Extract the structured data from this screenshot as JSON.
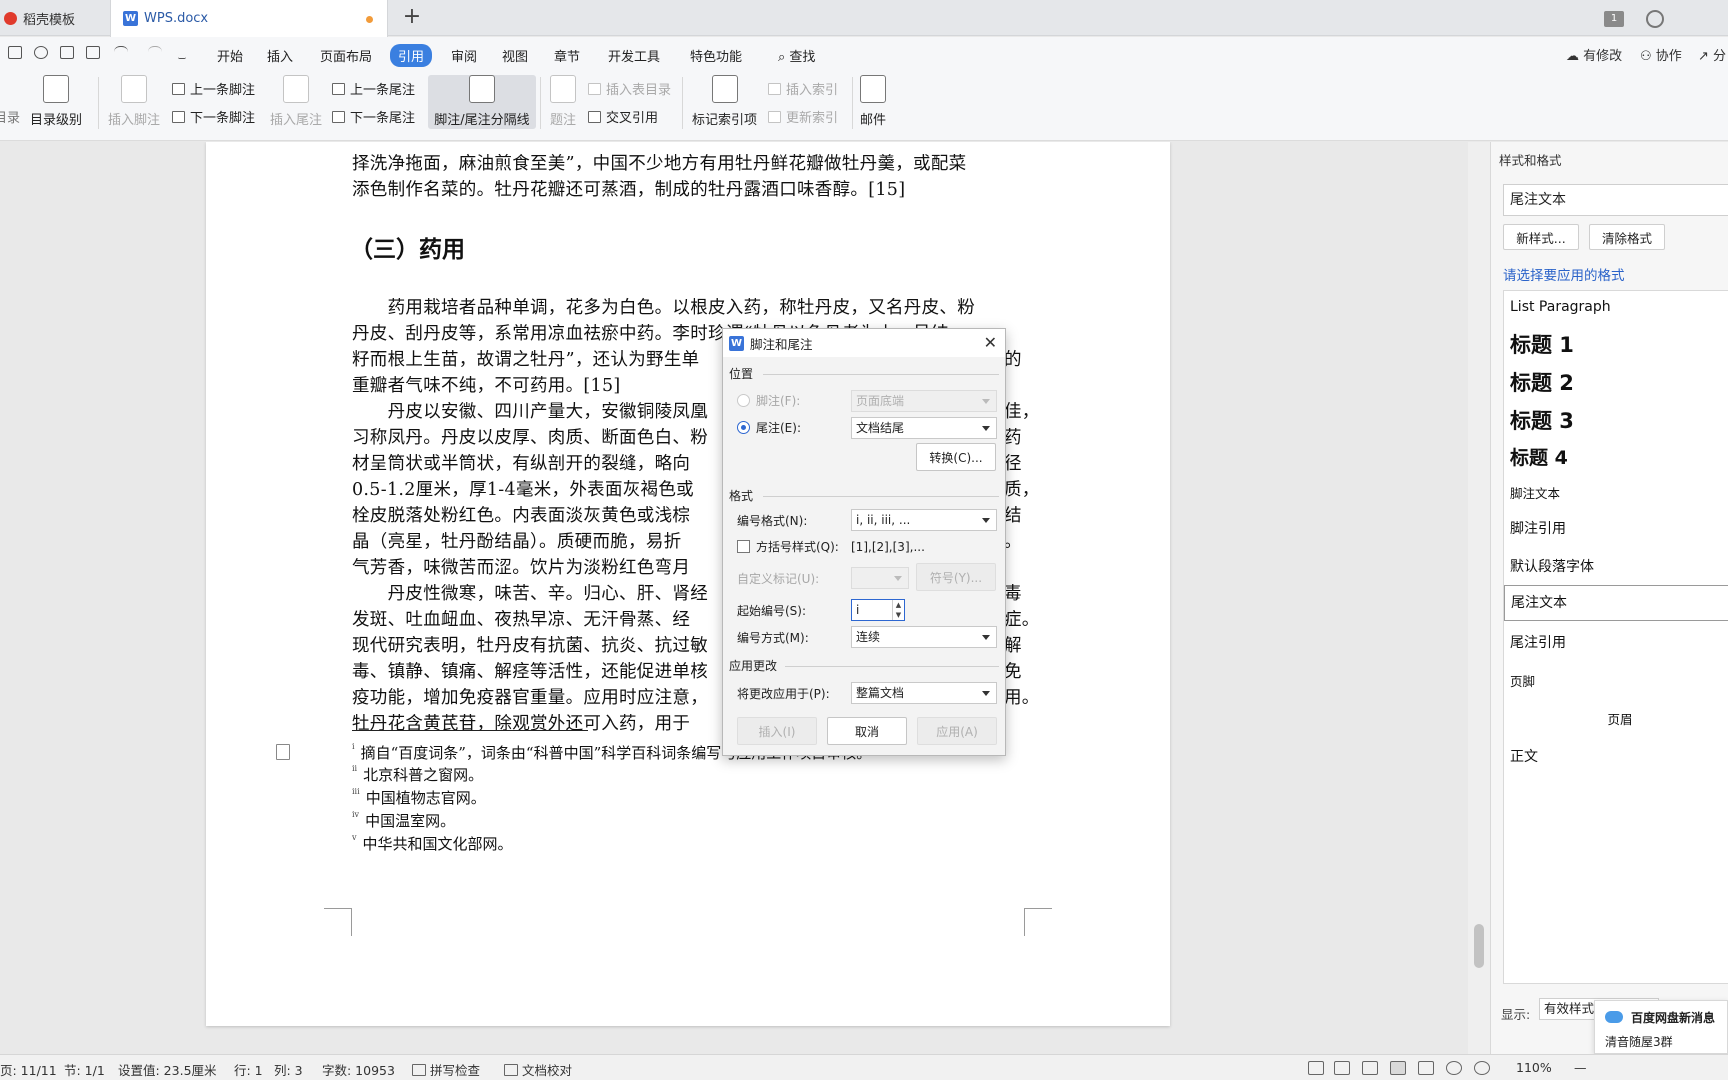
{
  "tabs": {
    "daoke_label": "稻壳模板",
    "doc_label": "WPS.docx",
    "new_tab_symbol": "+",
    "right_badge": "1"
  },
  "menu": {
    "items": [
      "开始",
      "插入",
      "页面布局",
      "引用",
      "审阅",
      "视图",
      "章节",
      "开发工具",
      "特色功能"
    ],
    "active": "引用",
    "search_label": "查找",
    "modified_label": "有修改",
    "collab_label": "协作",
    "share_label": "分"
  },
  "ribbon": {
    "catalog_partial": "目录",
    "catalog_level": "目录级别",
    "insert_footnote": "插入脚注",
    "prev_footnote": "上一条脚注",
    "next_footnote": "下一条脚注",
    "insert_endnote": "插入尾注",
    "prev_endnote": "上一条尾注",
    "next_endnote": "下一条尾注",
    "separator_label": "脚注/尾注分隔线",
    "caption_label": "题注",
    "insert_table_catalog": "插入表目录",
    "cross_ref": "交叉引用",
    "mark_index": "标记索引项",
    "insert_index": "插入索引",
    "update_index": "更新索引",
    "mail": "邮件"
  },
  "document": {
    "lines_top": [
      "择洗净拖面，麻油煎食至美”，中国不少地方有用牡丹鲜花瓣做牡丹羹，或配菜",
      "添色制作名菜的。牡丹花瓣还可蒸酒，制成的牡丹露酒口味香醇。[15]"
    ],
    "heading": "（三）药用",
    "para1": [
      "　　药用栽培者品种单调，花多为白色。以根皮入药，称牡丹皮，又名丹皮、粉",
      "丹皮、刮丹皮等，系常用凉血祛瘀中药。李时珍谓“牡丹以色丹者为上，虽结",
      "籽而根上生苗，故谓之牡丹”，还认为野生单",
      "重瓣者气味不纯，不可药用。[15]"
    ],
    "para1_right": [
      "",
      "",
      "的",
      ""
    ],
    "para2": [
      "　　丹皮以安徽、四川产量大，安徽铜陵凤凰",
      "习称凤丹。丹皮以皮厚、肉质、断面色白、粉",
      "材呈筒状或半筒状，有纵剖开的裂缝，略向",
      "0.5-1.2厘米，厚1-4毫米，外表面灰褐色或",
      "栓皮脱落处粉红色。内表面淡灰黄色或浅棕",
      "晶（亮星，牡丹酚结晶）。质硬而脆，易折",
      "气芳香，味微苦而涩。饮片为淡粉红色弯月"
    ],
    "para2_right": [
      "佳，",
      "药",
      "径",
      "质，",
      "结",
      "。",
      ""
    ],
    "para3": [
      "　　丹皮性微寒，味苦、辛。归心、肝、肾经",
      "发斑、吐血衄血、夜热早凉、无汗骨蒸、经",
      "现代研究表明，牡丹皮有抗菌、抗炎、抗过敏",
      "毒、镇静、镇痛、解痉等活性，还能促进单核",
      "疫功能，增加免疫器官重量。应用时应注意，",
      "牡丹花含黄芪苷，除观赏外还可入药，用于"
    ],
    "para3_right": [
      "毒",
      "症。",
      "解",
      "免",
      "用。",
      ""
    ],
    "footnotes": [
      {
        "mark": "i",
        "text": "摘自“百度词条”，词条由“科普中国”科学百科词条编写与应用工作项目审核。"
      },
      {
        "mark": "ii",
        "text": "北京科普之窗网。"
      },
      {
        "mark": "iii",
        "text": "中国植物志官网。"
      },
      {
        "mark": "iv",
        "text": "中国温室网。"
      },
      {
        "mark": "v",
        "text": "中华共和国文化部网。"
      }
    ]
  },
  "dialog": {
    "title": "脚注和尾注",
    "section_position": "位置",
    "footnote_label": "脚注(F):",
    "footnote_value": "页面底端",
    "endnote_label": "尾注(E):",
    "endnote_value": "文档结尾",
    "convert_btn": "转换(C)...",
    "section_format": "格式",
    "number_format_label": "编号格式(N):",
    "number_format_value": "i, ii, iii, ...",
    "bracket_label": "方括号样式(Q):",
    "bracket_value": "[1],[2],[3],...",
    "custom_mark_label": "自定义标记(U):",
    "symbol_btn": "符号(Y)...",
    "start_num_label": "起始编号(S):",
    "start_num_value": "i",
    "numbering_label": "编号方式(M):",
    "numbering_value": "连续",
    "section_apply": "应用更改",
    "apply_to_label": "将更改应用于(P):",
    "apply_to_value": "整篇文档",
    "insert_btn": "插入(I)",
    "cancel_btn": "取消",
    "apply_btn": "应用(A)"
  },
  "rightpane": {
    "title": "样式和格式",
    "current_style": "尾注文本",
    "new_style_btn": "新样式...",
    "clear_format_btn": "清除格式",
    "prompt": "请选择要应用的格式",
    "styles": [
      "List Paragraph",
      "标题 1",
      "标题 2",
      "标题 3",
      "标题 4",
      "脚注文本",
      "脚注引用",
      "默认段落字体",
      "尾注文本",
      "尾注引用",
      "页脚",
      "页眉",
      "正文"
    ],
    "selected_style": "尾注文本",
    "show_label": "显示:",
    "show_value": "有效样式"
  },
  "notification": {
    "title": "百度网盘新消息",
    "body": "清音随屋3群"
  },
  "statusbar": {
    "page": "页: 11/11",
    "section": "节: 1/1",
    "setting": "设置值: 23.5厘米",
    "row": "行: 1",
    "col": "列: 3",
    "words": "字数: 10953",
    "spellcheck": "拼写检查",
    "proofread": "文档校对",
    "zoom": "110%"
  }
}
